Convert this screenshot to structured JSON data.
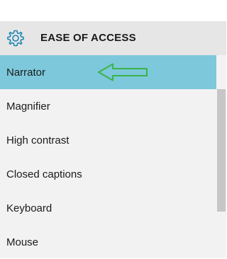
{
  "header": {
    "icon": "gear-icon",
    "title": "EASE OF ACCESS"
  },
  "nav": {
    "selected_index": 0,
    "items": [
      {
        "label": "Narrator"
      },
      {
        "label": "Magnifier"
      },
      {
        "label": "High contrast"
      },
      {
        "label": "Closed captions"
      },
      {
        "label": "Keyboard"
      },
      {
        "label": "Mouse"
      }
    ]
  },
  "annotation": {
    "icon": "left-arrow-icon",
    "color": "#3cb34a"
  },
  "colors": {
    "accent_selection": "#7dc8db",
    "gear_icon": "#1e86b4",
    "header_bg": "#e6e6e6",
    "panel_bg": "#f2f2f2",
    "scrollbar_thumb": "#c6c6c6"
  }
}
